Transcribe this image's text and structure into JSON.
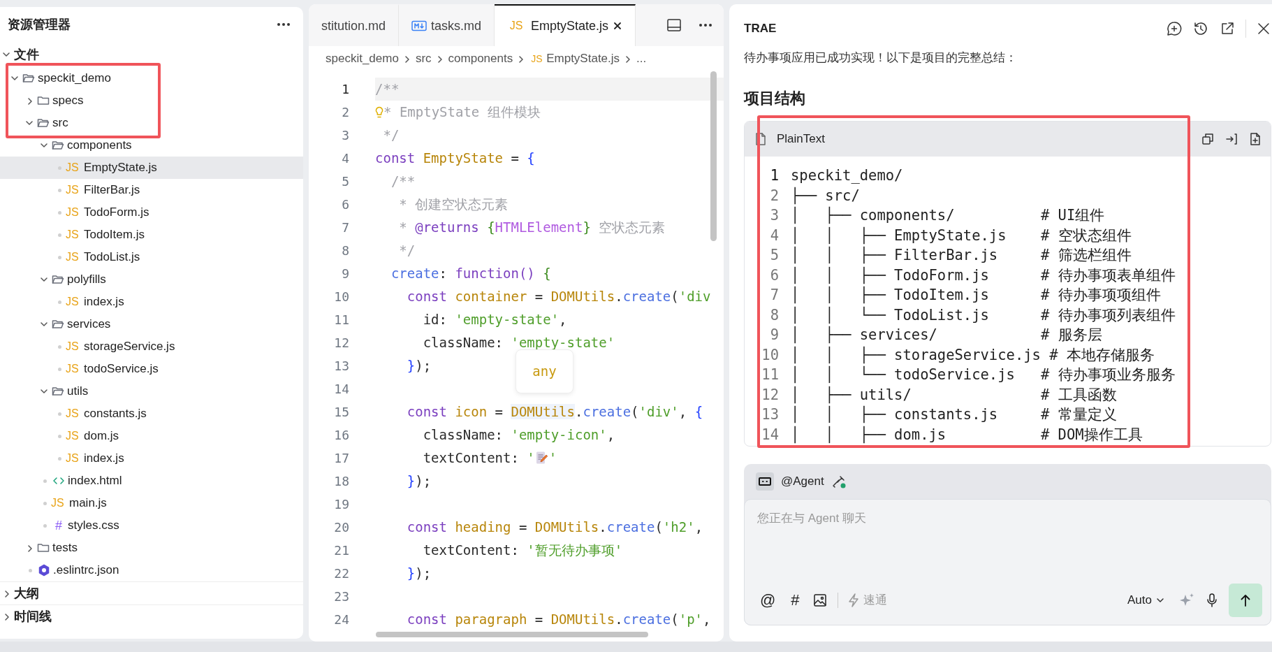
{
  "explorer": {
    "title": "资源管理器",
    "sections": [
      {
        "label": "文件",
        "expanded": true,
        "tree": [
          {
            "label": "speckit_demo",
            "kind": "folder",
            "expanded": true,
            "selected": false,
            "children": [
              {
                "label": "specs",
                "kind": "folder",
                "expanded": false,
                "selected": false
              },
              {
                "label": "src",
                "kind": "folder",
                "expanded": true,
                "selected": false,
                "children": [
                  {
                    "label": "components",
                    "kind": "folder",
                    "expanded": true,
                    "selected": false,
                    "children": [
                      {
                        "label": "EmptyState.js",
                        "kind": "js",
                        "icon": "JS",
                        "selected": true
                      },
                      {
                        "label": "FilterBar.js",
                        "kind": "js",
                        "icon": "JS",
                        "selected": false
                      },
                      {
                        "label": "TodoForm.js",
                        "kind": "js",
                        "icon": "JS",
                        "selected": false
                      },
                      {
                        "label": "TodoItem.js",
                        "kind": "js",
                        "icon": "JS",
                        "selected": false
                      },
                      {
                        "label": "TodoList.js",
                        "kind": "js",
                        "icon": "JS",
                        "selected": false
                      }
                    ]
                  },
                  {
                    "label": "polyfills",
                    "kind": "folder",
                    "expanded": true,
                    "selected": false,
                    "children": [
                      {
                        "label": "index.js",
                        "kind": "js",
                        "icon": "JS",
                        "selected": false
                      }
                    ]
                  },
                  {
                    "label": "services",
                    "kind": "folder",
                    "expanded": true,
                    "selected": false,
                    "children": [
                      {
                        "label": "storageService.js",
                        "kind": "js",
                        "icon": "JS",
                        "selected": false
                      },
                      {
                        "label": "todoService.js",
                        "kind": "js",
                        "icon": "JS",
                        "selected": false
                      }
                    ]
                  },
                  {
                    "label": "utils",
                    "kind": "folder",
                    "expanded": true,
                    "selected": false,
                    "children": [
                      {
                        "label": "constants.js",
                        "kind": "js",
                        "icon": "JS",
                        "selected": false
                      },
                      {
                        "label": "dom.js",
                        "kind": "js",
                        "icon": "JS",
                        "selected": false
                      },
                      {
                        "label": "index.js",
                        "kind": "js",
                        "icon": "JS",
                        "selected": false
                      }
                    ]
                  },
                  {
                    "label": "index.html",
                    "kind": "html",
                    "selected": false
                  },
                  {
                    "label": "main.js",
                    "kind": "js",
                    "icon": "JS",
                    "selected": false
                  },
                  {
                    "label": "styles.css",
                    "kind": "css",
                    "icon": "#",
                    "selected": false
                  }
                ]
              },
              {
                "label": "tests",
                "kind": "folder",
                "expanded": false,
                "selected": false
              },
              {
                "label": ".eslintrc.json",
                "kind": "json",
                "selected": false
              }
            ]
          }
        ]
      },
      {
        "label": "大纲",
        "expanded": false
      },
      {
        "label": "时间线",
        "expanded": false
      }
    ]
  },
  "editor": {
    "tabs": [
      {
        "label": "stitution.md",
        "kind": "plain",
        "selected": false
      },
      {
        "label": "tasks.md",
        "kind": "markdown",
        "selected": false
      },
      {
        "label": "EmptyState.js",
        "kind": "js",
        "icon": "JS",
        "selected": true
      }
    ],
    "breadcrumb": [
      {
        "label": "speckit_demo"
      },
      {
        "label": "src"
      },
      {
        "label": "components"
      },
      {
        "label": "EmptyState.js",
        "icon": "JS"
      },
      {
        "label": "..."
      }
    ],
    "hover_tooltip": "any",
    "lines": [
      {
        "number": "1",
        "current": true,
        "tokens": [
          {
            "kind": "comment",
            "text": "/**"
          }
        ]
      },
      {
        "number": "2",
        "current": false,
        "hint": true,
        "tokens": [
          {
            "kind": "comment",
            "text": "* EmptyState 组件模块"
          }
        ]
      },
      {
        "number": "3",
        "current": false,
        "tokens": [
          {
            "kind": "comment",
            "text": " */"
          }
        ]
      },
      {
        "number": "4",
        "current": false,
        "tokens": [
          {
            "kind": "keyword",
            "text": "const "
          },
          {
            "kind": "ident",
            "text": "EmptyState"
          },
          {
            "kind": "plain",
            "text": " = "
          },
          {
            "kind": "brace",
            "text": "{"
          }
        ]
      },
      {
        "number": "5",
        "current": false,
        "tokens": [
          {
            "kind": "comment",
            "text": "  /**"
          }
        ]
      },
      {
        "number": "6",
        "current": false,
        "tokens": [
          {
            "kind": "comment",
            "text": "   * 创建空状态元素"
          }
        ]
      },
      {
        "number": "7",
        "current": false,
        "tokens": [
          {
            "kind": "comment",
            "text": "   * "
          },
          {
            "kind": "tag",
            "text": "@returns "
          },
          {
            "kind": "brace-alt",
            "text": "{"
          },
          {
            "kind": "type",
            "text": "HTMLElement"
          },
          {
            "kind": "brace-alt",
            "text": "}"
          },
          {
            "kind": "comment",
            "text": " 空状态元素"
          }
        ]
      },
      {
        "number": "8",
        "current": false,
        "tokens": [
          {
            "kind": "comment",
            "text": "   */"
          }
        ]
      },
      {
        "number": "9",
        "current": false,
        "tokens": [
          {
            "kind": "method",
            "text": "  create"
          },
          {
            "kind": "plain",
            "text": ": "
          },
          {
            "kind": "keyword",
            "text": "function()"
          },
          {
            "kind": "brace-alt",
            "text": " {"
          }
        ]
      },
      {
        "number": "10",
        "current": false,
        "tokens": [
          {
            "kind": "keyword",
            "text": "    const "
          },
          {
            "kind": "ident",
            "text": "container"
          },
          {
            "kind": "plain",
            "text": " = "
          },
          {
            "kind": "ident",
            "text": "DOMUtils"
          },
          {
            "kind": "plain",
            "text": "."
          },
          {
            "kind": "method",
            "text": "create"
          },
          {
            "kind": "plain",
            "text": "("
          },
          {
            "kind": "string",
            "text": "'div"
          }
        ]
      },
      {
        "number": "11",
        "current": false,
        "tokens": [
          {
            "kind": "plain",
            "text": "      id: "
          },
          {
            "kind": "string",
            "text": "'empty-state'"
          },
          {
            "kind": "plain",
            "text": ","
          }
        ]
      },
      {
        "number": "12",
        "current": false,
        "tokens": [
          {
            "kind": "plain",
            "text": "      className: "
          },
          {
            "kind": "string",
            "text": "'empty-state'"
          }
        ]
      },
      {
        "number": "13",
        "current": false,
        "tokens": [
          {
            "kind": "brace",
            "text": "    }"
          },
          {
            "kind": "plain",
            "text": ");"
          }
        ]
      },
      {
        "number": "14",
        "current": false
      },
      {
        "number": "15",
        "current": false,
        "tokens": [
          {
            "kind": "keyword",
            "text": "    const "
          },
          {
            "kind": "ident",
            "text": "icon"
          },
          {
            "kind": "plain",
            "text": " = "
          },
          {
            "kind": "ident",
            "text": "DOMUtils",
            "hover": true
          },
          {
            "kind": "plain",
            "text": "."
          },
          {
            "kind": "method",
            "text": "create"
          },
          {
            "kind": "plain",
            "text": "("
          },
          {
            "kind": "string",
            "text": "'div'"
          },
          {
            "kind": "plain",
            "text": ", "
          },
          {
            "kind": "brace",
            "text": "{"
          }
        ]
      },
      {
        "number": "16",
        "current": false,
        "tokens": [
          {
            "kind": "plain",
            "text": "      className: "
          },
          {
            "kind": "string",
            "text": "'empty-icon'"
          },
          {
            "kind": "plain",
            "text": ","
          }
        ]
      },
      {
        "number": "17",
        "current": false,
        "tokens": [
          {
            "kind": "plain",
            "text": "      textContent: "
          },
          {
            "kind": "string",
            "text": "'"
          },
          {
            "kind": "memo"
          },
          {
            "kind": "string",
            "text": "'"
          }
        ]
      },
      {
        "number": "18",
        "current": false,
        "tokens": [
          {
            "kind": "brace",
            "text": "    }"
          },
          {
            "kind": "plain",
            "text": ");"
          }
        ]
      },
      {
        "number": "19",
        "current": false
      },
      {
        "number": "20",
        "current": false,
        "tokens": [
          {
            "kind": "keyword",
            "text": "    const "
          },
          {
            "kind": "ident",
            "text": "heading"
          },
          {
            "kind": "plain",
            "text": " = "
          },
          {
            "kind": "ident",
            "text": "DOMUtils"
          },
          {
            "kind": "plain",
            "text": "."
          },
          {
            "kind": "method",
            "text": "create"
          },
          {
            "kind": "plain",
            "text": "("
          },
          {
            "kind": "string",
            "text": "'h2'"
          },
          {
            "kind": "plain",
            "text": ","
          }
        ]
      },
      {
        "number": "21",
        "current": false,
        "tokens": [
          {
            "kind": "plain",
            "text": "      textContent: "
          },
          {
            "kind": "string",
            "text": "'暂无待办事项'"
          }
        ]
      },
      {
        "number": "22",
        "current": false,
        "tokens": [
          {
            "kind": "brace",
            "text": "    }"
          },
          {
            "kind": "plain",
            "text": ");"
          }
        ]
      },
      {
        "number": "23",
        "current": false
      },
      {
        "number": "24",
        "current": false,
        "tokens": [
          {
            "kind": "keyword",
            "text": "    const "
          },
          {
            "kind": "ident",
            "text": "paragraph"
          },
          {
            "kind": "plain",
            "text": " = "
          },
          {
            "kind": "ident",
            "text": "DOMUtils"
          },
          {
            "kind": "plain",
            "text": "."
          },
          {
            "kind": "method",
            "text": "create"
          },
          {
            "kind": "plain",
            "text": "("
          },
          {
            "kind": "string",
            "text": "'p'"
          },
          {
            "kind": "plain",
            "text": ","
          }
        ]
      }
    ]
  },
  "chat": {
    "title": "TRAE",
    "message": "待办事项应用已成功实现！以下是项目的完整总结：",
    "heading": "项目结构",
    "code_block": {
      "language": "PlainText",
      "lines": [
        {
          "number": "1",
          "current": true,
          "text": "speckit_demo/"
        },
        {
          "number": "2",
          "current": false,
          "text": "├── src/"
        },
        {
          "number": "3",
          "current": false,
          "text": "│   ├── components/          # UI组件"
        },
        {
          "number": "4",
          "current": false,
          "text": "│   │   ├── EmptyState.js    # 空状态组件"
        },
        {
          "number": "5",
          "current": false,
          "text": "│   │   ├── FilterBar.js     # 筛选栏组件"
        },
        {
          "number": "6",
          "current": false,
          "text": "│   │   ├── TodoForm.js      # 待办事项表单组件"
        },
        {
          "number": "7",
          "current": false,
          "text": "│   │   ├── TodoItem.js      # 待办事项项组件"
        },
        {
          "number": "8",
          "current": false,
          "text": "│   │   └── TodoList.js      # 待办事项列表组件"
        },
        {
          "number": "9",
          "current": false,
          "text": "│   ├── services/            # 服务层"
        },
        {
          "number": "10",
          "current": false,
          "text": "│   │   ├── storageService.js # 本地存储服务"
        },
        {
          "number": "11",
          "current": false,
          "text": "│   │   └── todoService.js   # 待办事项业务服务"
        },
        {
          "number": "12",
          "current": false,
          "text": "│   ├── utils/               # 工具函数"
        },
        {
          "number": "13",
          "current": false,
          "text": "│   │   ├── constants.js     # 常量定义"
        },
        {
          "number": "14",
          "current": false,
          "text": "│   │   ├── dom.js           # DOM操作工具"
        }
      ]
    },
    "composer": {
      "agent": "@Agent",
      "agent_online": true,
      "placeholder": "您正在与 Agent 聊天",
      "mention": "@",
      "topic": "#",
      "mode": {
        "label": "速通",
        "on": false
      },
      "model": "Auto"
    }
  }
}
